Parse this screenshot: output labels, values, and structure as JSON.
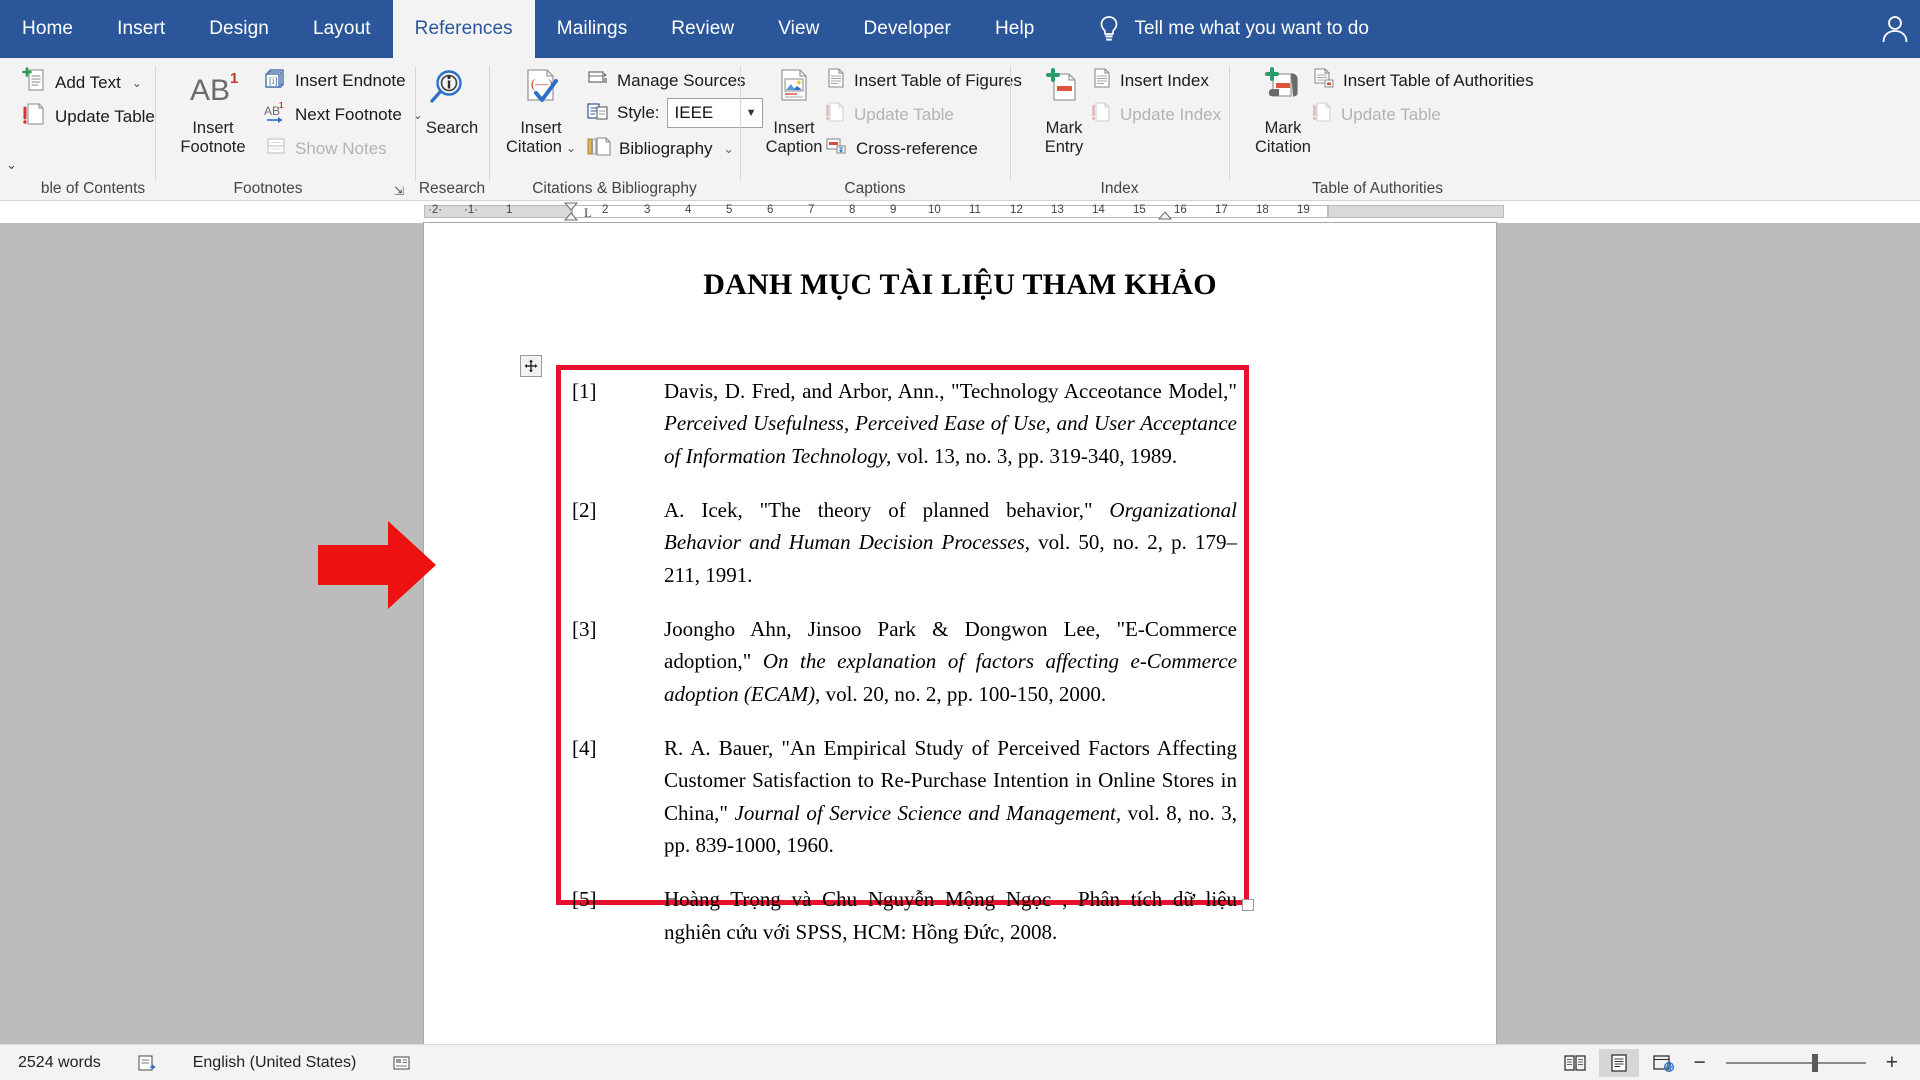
{
  "tabs": [
    {
      "label": "Home",
      "active": false
    },
    {
      "label": "Insert",
      "active": false
    },
    {
      "label": "Design",
      "active": false
    },
    {
      "label": "Layout",
      "active": false
    },
    {
      "label": "References",
      "active": true
    },
    {
      "label": "Mailings",
      "active": false
    },
    {
      "label": "Review",
      "active": false
    },
    {
      "label": "View",
      "active": false
    },
    {
      "label": "Developer",
      "active": false
    },
    {
      "label": "Help",
      "active": false
    }
  ],
  "tell_me": "Tell me what you want to do",
  "ribbon": {
    "groups": [
      {
        "name": "table-of-contents",
        "label": "ble of Contents"
      },
      {
        "name": "footnotes",
        "label": "Footnotes"
      },
      {
        "name": "research",
        "label": "Research"
      },
      {
        "name": "citations-bibliography",
        "label": "Citations & Bibliography"
      },
      {
        "name": "captions",
        "label": "Captions"
      },
      {
        "name": "index",
        "label": "Index"
      },
      {
        "name": "table-of-authorities",
        "label": "Table of Authorities"
      }
    ],
    "toc": {
      "add_text": "Add Text",
      "update_table": "Update Table"
    },
    "footnotes": {
      "insert_footnote_line1": "Insert",
      "insert_footnote_line2": "Footnote",
      "insert_endnote": "Insert Endnote",
      "next_footnote": "Next Footnote",
      "show_notes": "Show Notes"
    },
    "research": {
      "search_label": "Search"
    },
    "citations": {
      "insert_citation_line1": "Insert",
      "insert_citation_line2": "Citation",
      "manage_sources": "Manage Sources",
      "style_label": "Style:",
      "style_value": "IEEE",
      "bibliography": "Bibliography"
    },
    "captions": {
      "insert_caption_line1": "Insert",
      "insert_caption_line2": "Caption",
      "insert_table_of_figures": "Insert Table of Figures",
      "update_table": "Update Table",
      "cross_reference": "Cross-reference"
    },
    "index": {
      "mark_entry_line1": "Mark",
      "mark_entry_line2": "Entry",
      "insert_index": "Insert Index",
      "update_index": "Update Index"
    },
    "authorities": {
      "mark_citation_line1": "Mark",
      "mark_citation_line2": "Citation",
      "insert_table_of_authorities": "Insert Table of Authorities",
      "update_table": "Update Table"
    }
  },
  "ruler": {
    "left_ticks": [
      "·2·",
      "·1·",
      "1"
    ],
    "ticks": [
      "2",
      "3",
      "4",
      "5",
      "6",
      "7",
      "8",
      "9",
      "10",
      "11",
      "12",
      "13",
      "14",
      "15",
      "16",
      "17",
      "18",
      "19"
    ]
  },
  "document": {
    "title": "DANH MỤC TÀI LIỆU THAM KHẢO",
    "references": [
      {
        "num": "[1]",
        "parts": [
          {
            "text": "Davis, D. Fred, and Arbor, Ann., \"Technology Acceotance Model,\" ",
            "italic": false
          },
          {
            "text": "Perceived Usefulness, Perceived Ease of Use, and User Acceptance of Information Technology,",
            "italic": true
          },
          {
            "text": " vol. 13, no. 3, pp. 319-340, 1989.",
            "italic": false
          }
        ]
      },
      {
        "num": "[2]",
        "parts": [
          {
            "text": "A. Icek, \"The theory of planned behavior,\" ",
            "italic": false
          },
          {
            "text": "Organizational Behavior and Human Decision Processes,",
            "italic": true
          },
          {
            "text": " vol. 50, no. 2, p. 179–211, 1991.",
            "italic": false
          }
        ]
      },
      {
        "num": "[3]",
        "parts": [
          {
            "text": "Joongho Ahn, Jinsoo Park & Dongwon Lee, \"E-Commerce adoption,\" ",
            "italic": false
          },
          {
            "text": "On the explanation of factors affecting e-Commerce adoption (ECAM),",
            "italic": true
          },
          {
            "text": " vol. 20, no. 2, pp. 100-150, 2000.",
            "italic": false
          }
        ]
      },
      {
        "num": "[4]",
        "parts": [
          {
            "text": "R. A. Bauer, \"An Empirical Study of Perceived Factors Affecting Customer Satisfaction to Re-Purchase Intention in Online Stores in China,\" ",
            "italic": false
          },
          {
            "text": "Journal of Service Science and Management,",
            "italic": true
          },
          {
            "text": " vol. 8, no. 3, pp. 839-1000, 1960.",
            "italic": false
          }
        ]
      },
      {
        "num": "[5]",
        "parts": [
          {
            "text": "Hoàng Trọng và Chu Nguyễn Mộng Ngọc , Phân tích dữ liệu nghiên cứu với SPSS, HCM: Hồng Đức, 2008.",
            "italic": false
          }
        ]
      }
    ]
  },
  "status": {
    "word_count": "2524 words",
    "proofing_label": "",
    "language": "English (United States)",
    "zoom_percent": 100
  },
  "colors": {
    "accent": "#2b579a",
    "highlight_box": "#e8112d",
    "arrow": "#ee1111",
    "ribbon_bg": "#f3f3f3",
    "canvas_bg": "#bcbcbc"
  }
}
